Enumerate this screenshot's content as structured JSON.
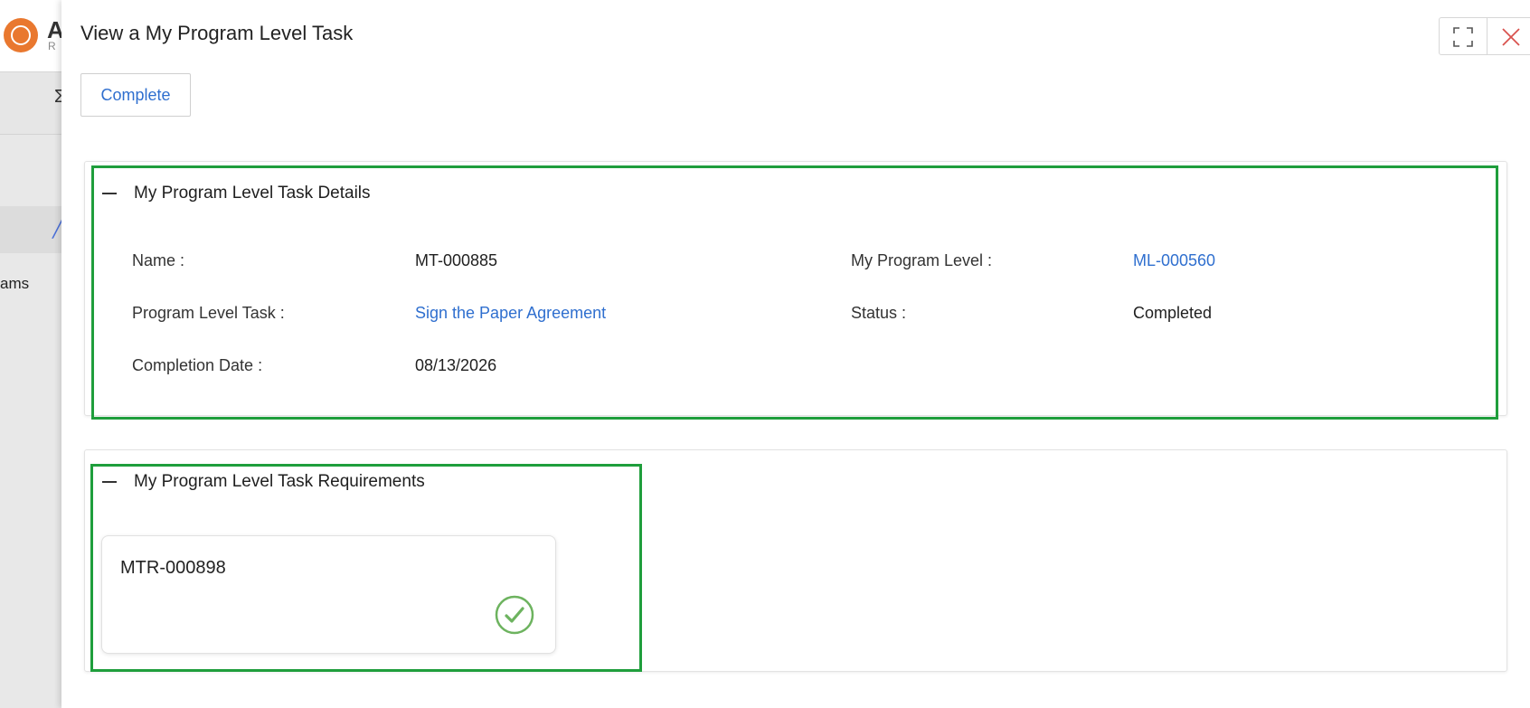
{
  "background": {
    "brand_letter": "A",
    "brand_sub": "R",
    "subbar_glyph": "Σ",
    "nav_partial_text": "ams"
  },
  "panel": {
    "title": "View a My Program Level Task",
    "complete_label": "Complete"
  },
  "details": {
    "section_title": "My Program Level Task Details",
    "name_label": "Name :",
    "name_value": "MT-000885",
    "program_level_label": "My Program Level :",
    "program_level_value": "ML-000560",
    "task_label": "Program Level Task :",
    "task_value": "Sign the Paper Agreement",
    "status_label": "Status :",
    "status_value": "Completed",
    "completion_label": "Completion Date :",
    "completion_value": "08/13/2026"
  },
  "requirements": {
    "section_title": "My Program Level Task Requirements",
    "items": [
      {
        "name": "MTR-000898",
        "status_icon": "check-circle-icon"
      }
    ]
  },
  "colors": {
    "accent_link": "#2f6fcf",
    "highlight_green": "#1f9e3c",
    "check_green": "#6db35f",
    "close_red": "#d9534f",
    "logo_orange": "#e9782f"
  }
}
